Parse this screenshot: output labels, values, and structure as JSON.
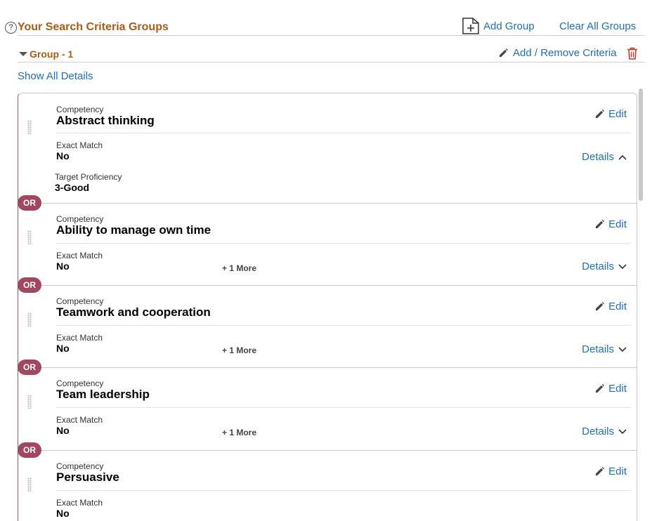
{
  "header": {
    "title": "Your Search Criteria Groups",
    "add_group": "Add Group",
    "clear_all": "Clear All Groups"
  },
  "group": {
    "title": "Group - 1",
    "add_remove": "Add / Remove Criteria",
    "show_all": "Show All Details"
  },
  "labels": {
    "competency": "Competency",
    "exact_match": "Exact Match",
    "target_proficiency": "Target Proficiency",
    "edit": "Edit",
    "details": "Details",
    "or": "OR"
  },
  "criteria": [
    {
      "competency": "Abstract thinking",
      "exact_match": "No",
      "target_proficiency": "3-Good",
      "expanded": true
    },
    {
      "competency": "Ability to manage own time",
      "exact_match": "No",
      "more": "+ 1 More"
    },
    {
      "competency": "Teamwork and cooperation",
      "exact_match": "No",
      "more": "+ 1 More"
    },
    {
      "competency": "Team leadership",
      "exact_match": "No",
      "more": "+ 1 More"
    },
    {
      "competency": "Persuasive",
      "exact_match": "No"
    }
  ]
}
